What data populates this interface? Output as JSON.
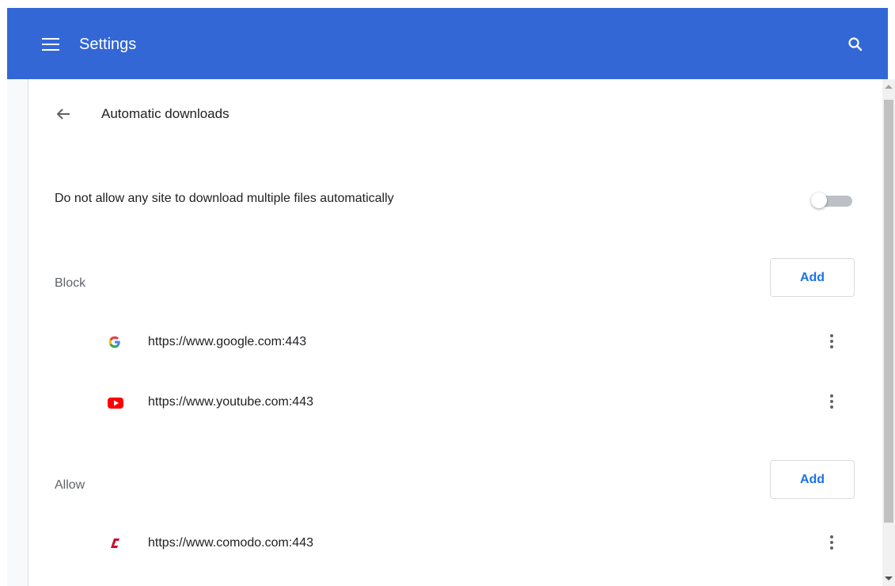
{
  "header": {
    "title": "Settings",
    "menu_icon": "hamburger-menu-icon",
    "search_icon": "search-icon",
    "background_color": "#3367d6"
  },
  "page": {
    "back_icon": "arrow-back-icon",
    "title": "Automatic downloads"
  },
  "setting": {
    "label": "Do not allow any site to download multiple files automatically",
    "toggle_on": false
  },
  "block": {
    "label": "Block",
    "add_label": "Add",
    "sites": [
      {
        "url": "https://www.google.com:443",
        "icon": "google-favicon-icon"
      },
      {
        "url": "https://www.youtube.com:443",
        "icon": "youtube-favicon-icon"
      }
    ]
  },
  "allow": {
    "label": "Allow",
    "add_label": "Add",
    "sites": [
      {
        "url": "https://www.comodo.com:443",
        "icon": "comodo-favicon-icon"
      }
    ]
  },
  "colors": {
    "accent": "#1a73e8",
    "youtube_red": "#ff0000",
    "comodo_red": "#c8102e"
  }
}
